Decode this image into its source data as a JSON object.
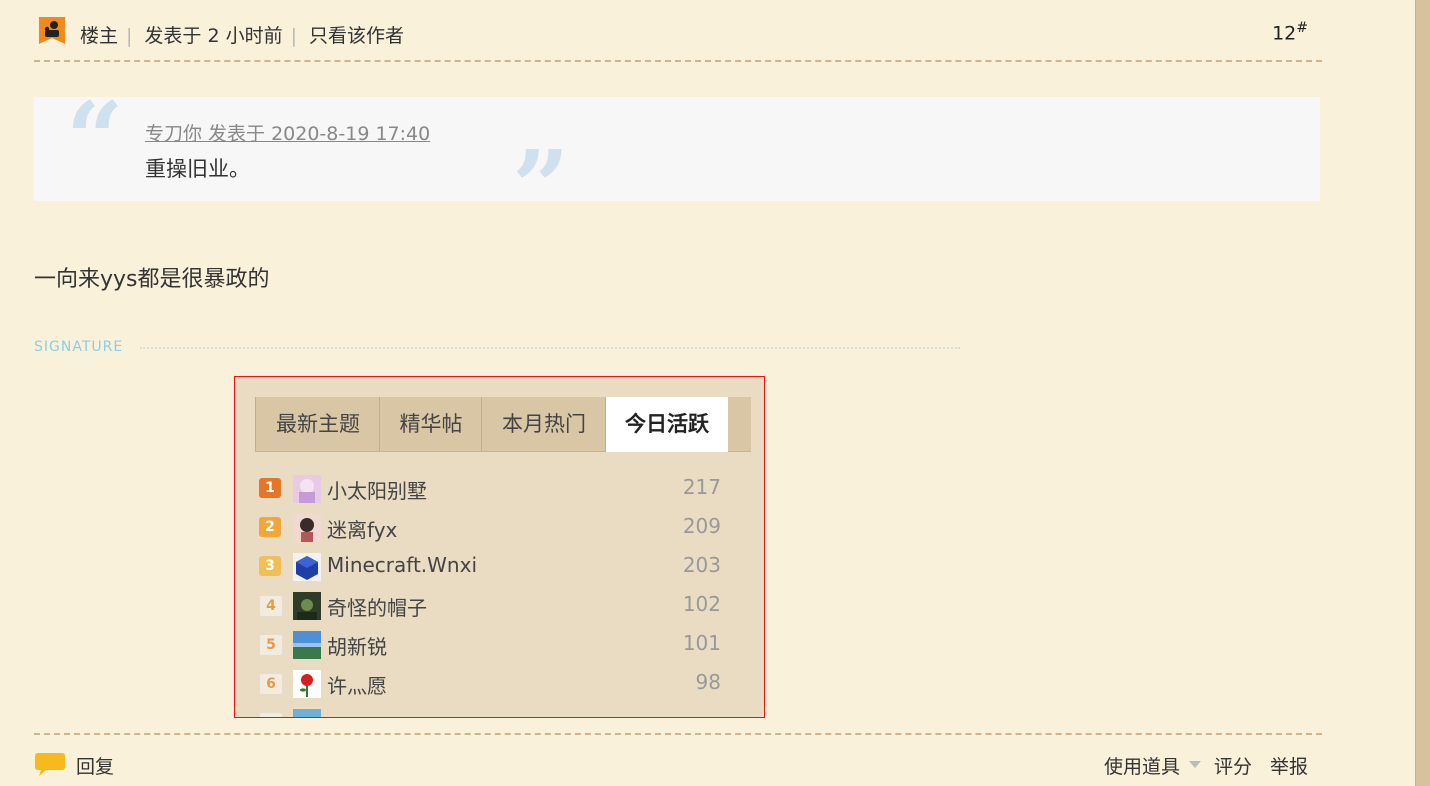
{
  "post_header": {
    "owner_label": "楼主",
    "posted": "发表于 2 小时前",
    "only_author": "只看该作者",
    "floor": "12",
    "floor_mark": "#"
  },
  "quote": {
    "author_line": "专刀你 发表于 2020-8-19 17:40",
    "text": "重操旧业。"
  },
  "post_body": "一向来yys都是很暴政的",
  "signature": {
    "label": "SIGNATURE",
    "tabs": [
      "最新主题",
      "精华帖",
      "本月热门",
      "今日活跃"
    ],
    "active_tab": "今日活跃",
    "ranking": [
      {
        "rank": "1",
        "name": "小太阳别墅",
        "count": "217"
      },
      {
        "rank": "2",
        "name": "迷离fyx",
        "count": "209"
      },
      {
        "rank": "3",
        "name": "Minecraft.Wnxi",
        "count": "203"
      },
      {
        "rank": "4",
        "name": "奇怪的帽子",
        "count": "102"
      },
      {
        "rank": "5",
        "name": "胡新锐",
        "count": "101"
      },
      {
        "rank": "6",
        "name": "许灬愿",
        "count": "98"
      }
    ]
  },
  "footer": {
    "reply": "回复",
    "use_tool": "使用道具",
    "rate": "评分",
    "report": "举报"
  },
  "colors": {
    "background": "#faf1da",
    "dash": "#d2b38b",
    "rank1": "#e4762a",
    "signature_label": "#8bcfe3",
    "signature_border": "#e11111"
  }
}
